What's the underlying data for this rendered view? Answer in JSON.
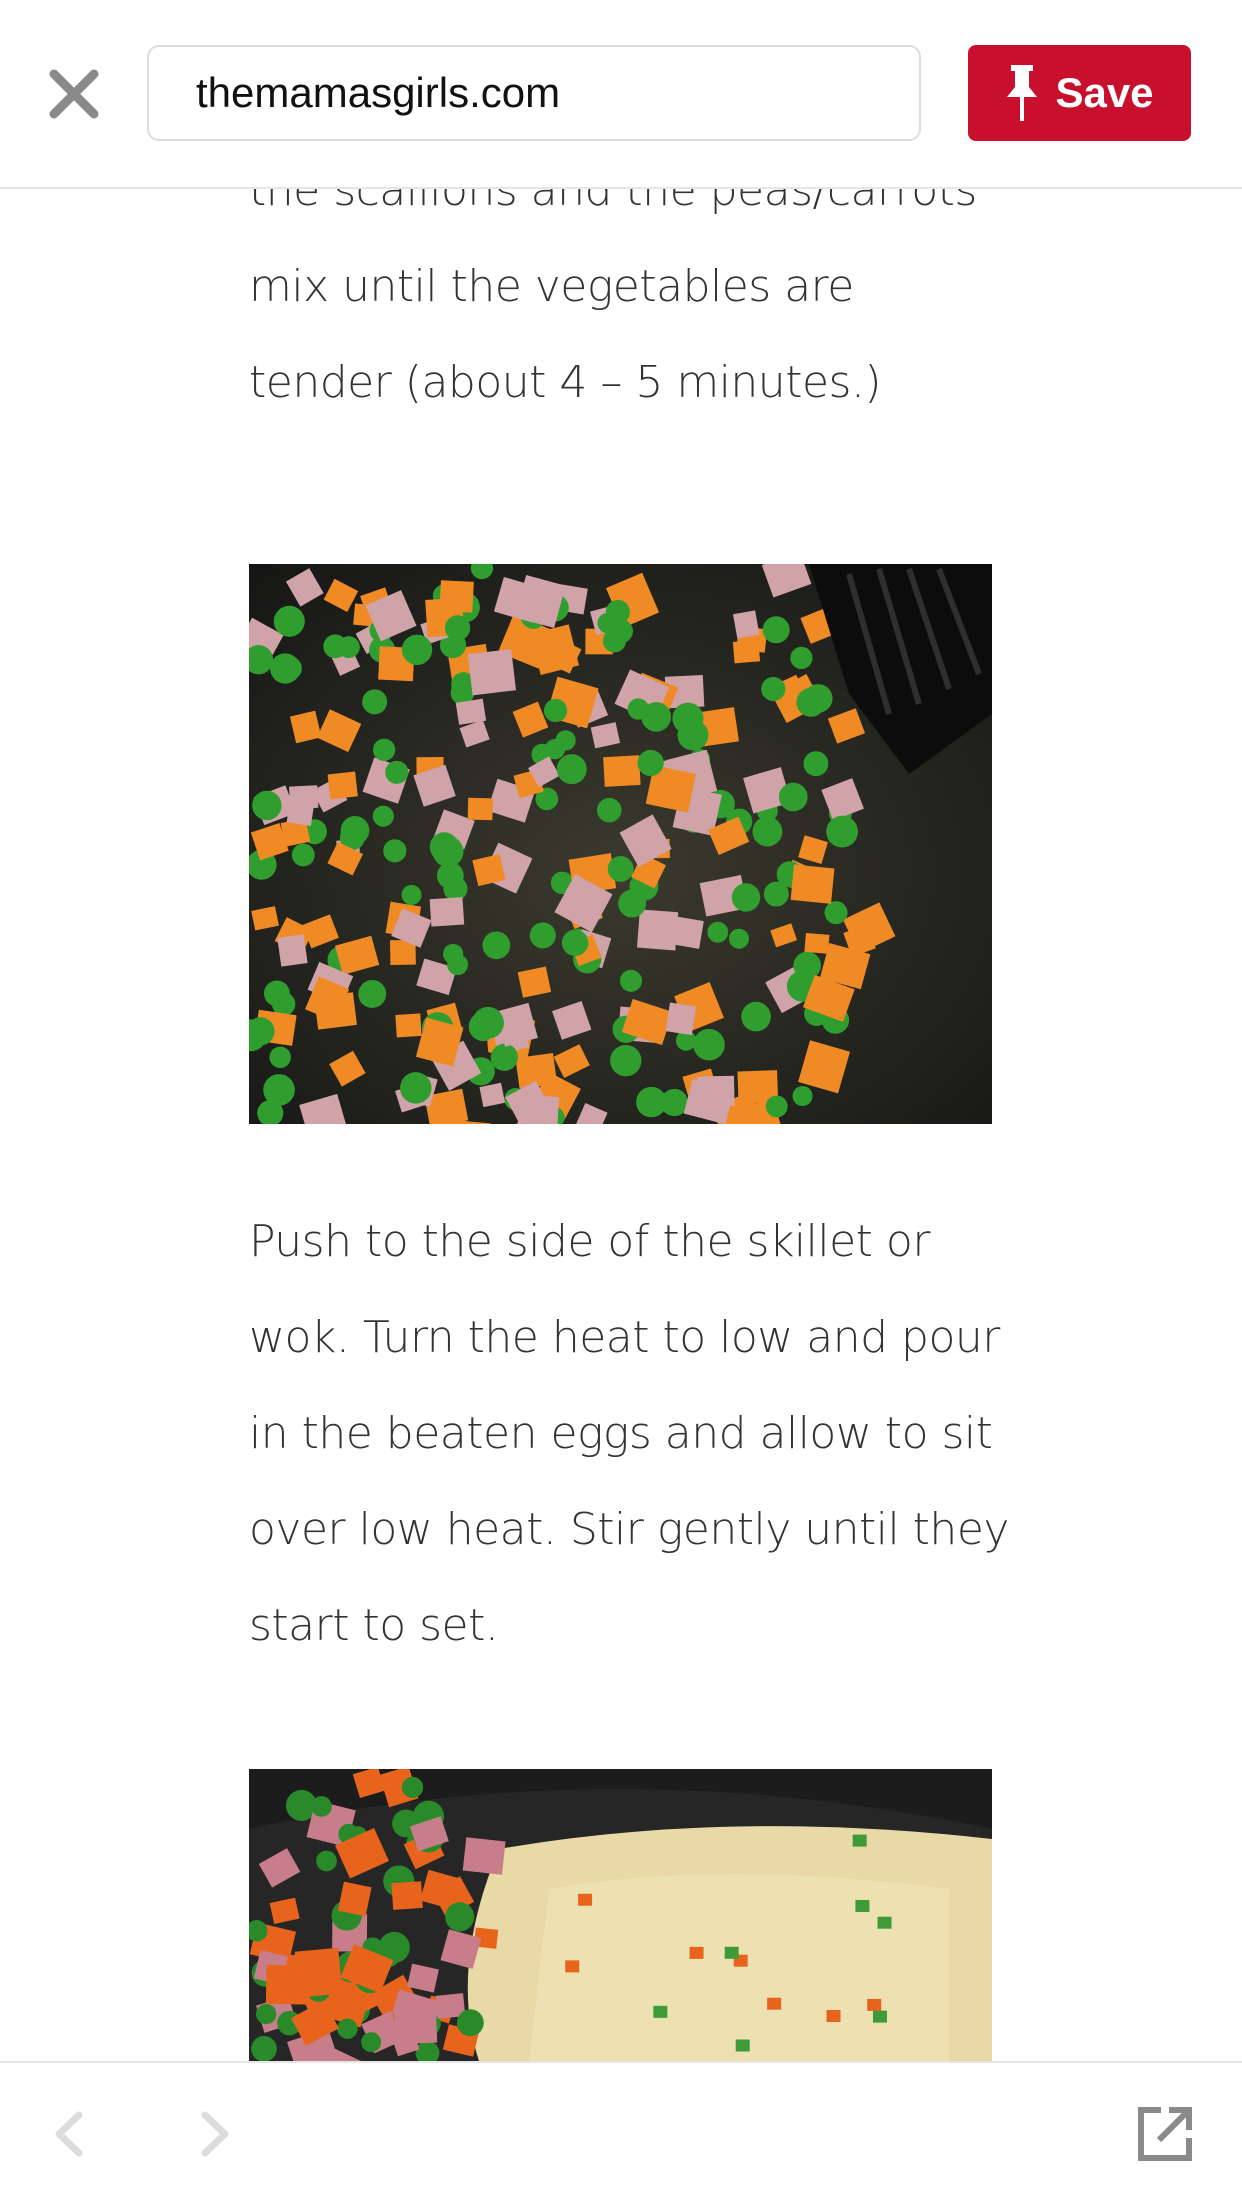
{
  "toolbar": {
    "close_icon": "close-icon",
    "url": "themamasgirls.com",
    "save_label": "Save",
    "save_icon": "pin-icon",
    "save_color": "#c8102e"
  },
  "article": {
    "paragraph_1": "the scallions and the peas/carrots mix until the vegetables are tender (about 4 – 5 minutes.)",
    "paragraph_2": "Push to the side of the skillet or wok. Turn the heat to low and pour in the beaten eggs and allow to sit over low heat. Stir gently until they start to set."
  },
  "bottom_bar": {
    "back_icon": "chevron-left-icon",
    "forward_icon": "chevron-right-icon",
    "open_external_icon": "open-external-icon"
  }
}
